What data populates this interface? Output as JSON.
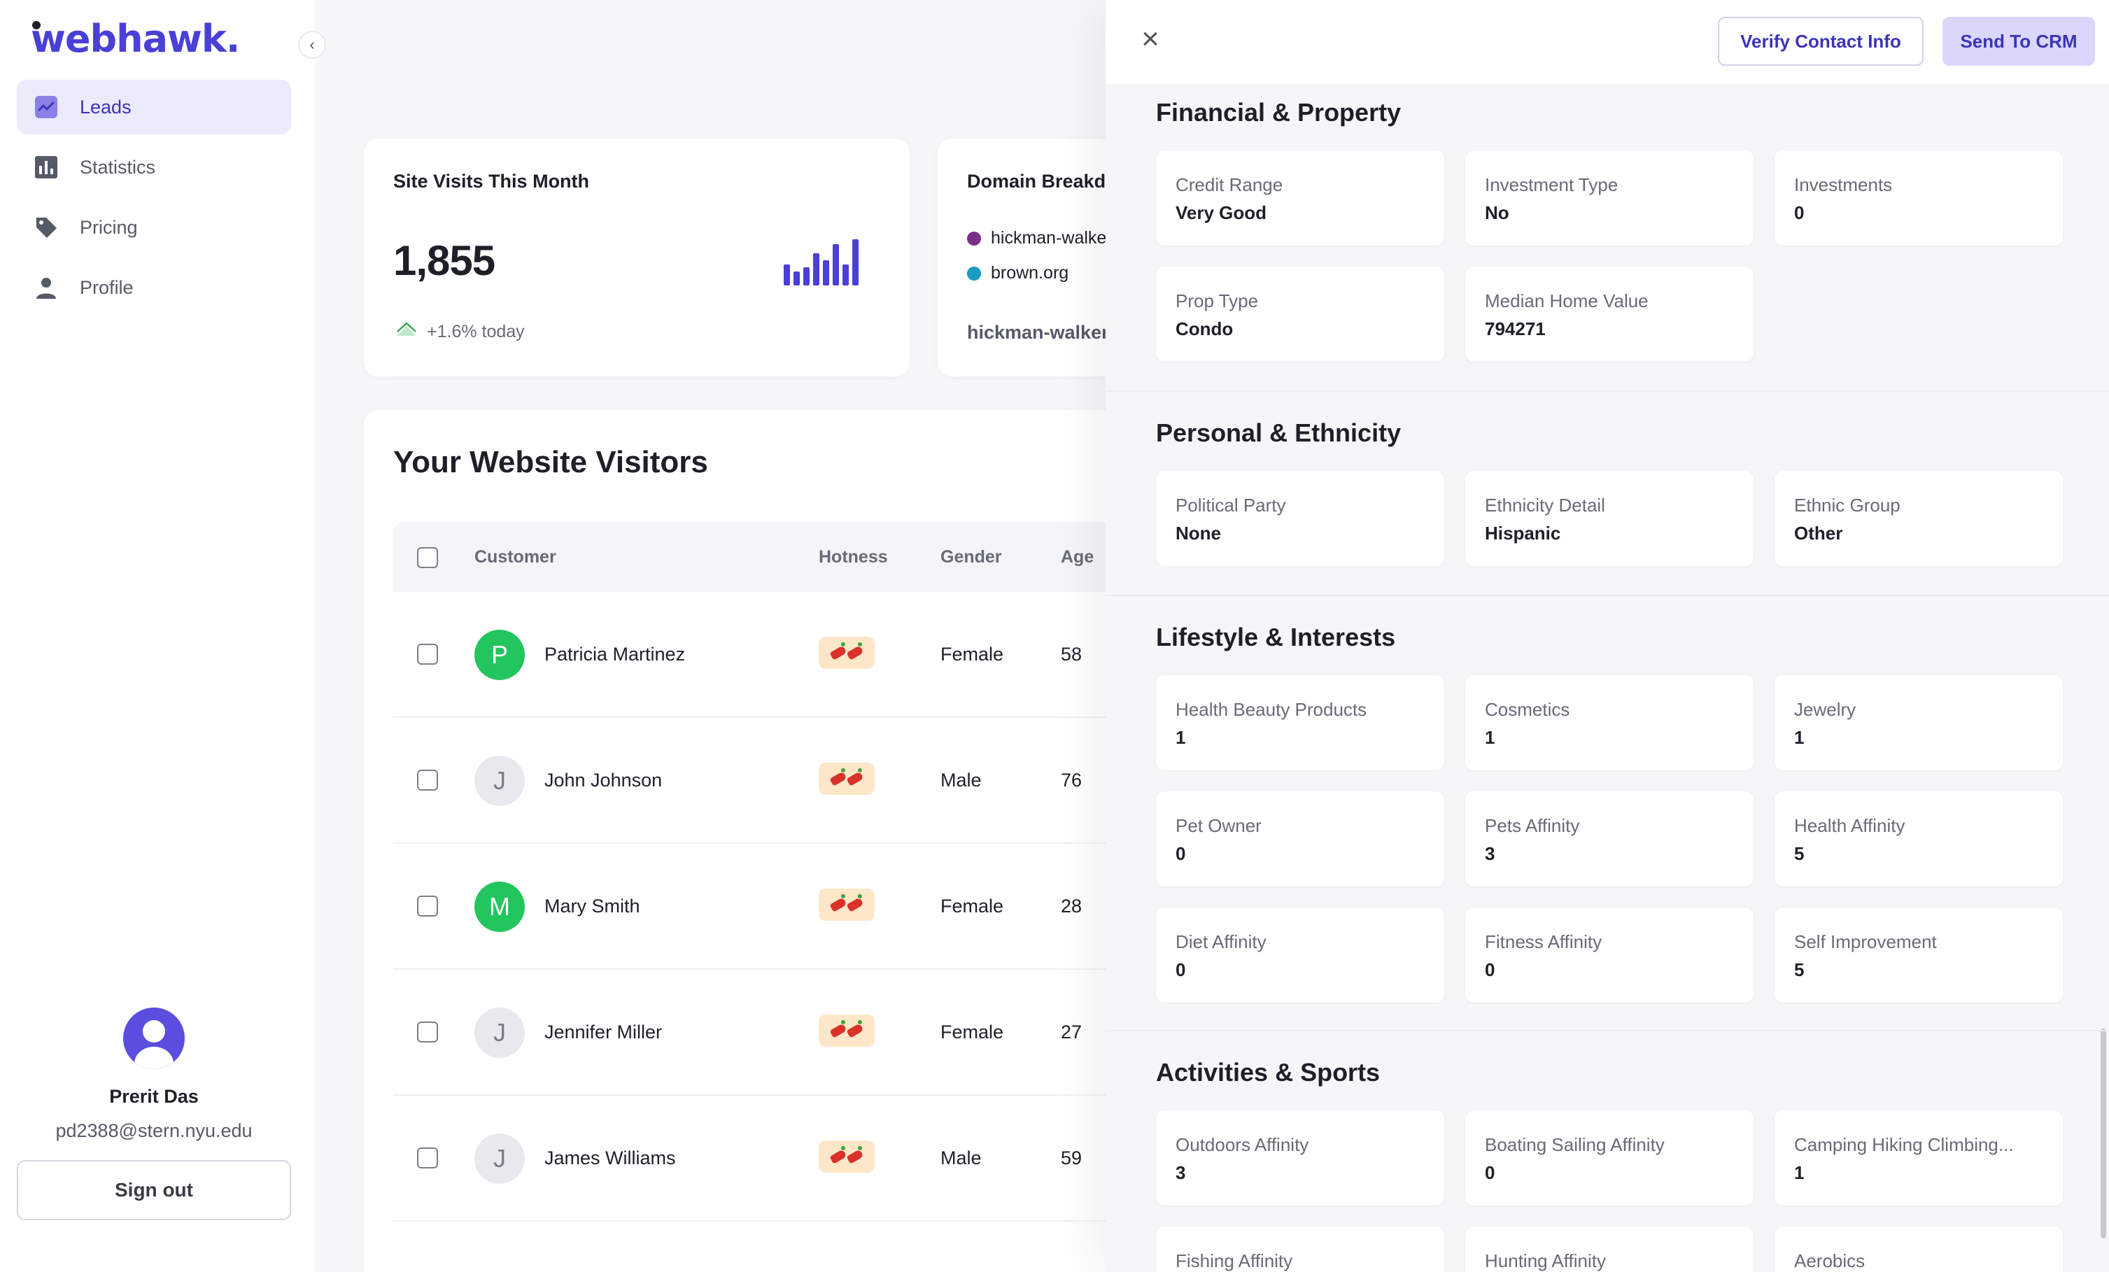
{
  "app": {
    "logo": "webhawk."
  },
  "sidebar": {
    "items": [
      {
        "label": "Leads",
        "icon": "trend-chart-icon",
        "active": true
      },
      {
        "label": "Statistics",
        "icon": "bar-chart-icon"
      },
      {
        "label": "Pricing",
        "icon": "tag-icon"
      },
      {
        "label": "Profile",
        "icon": "person-icon"
      }
    ],
    "user": {
      "name": "Prerit Das",
      "email": "pd2388@stern.nyu.edu"
    },
    "signout_label": "Sign out"
  },
  "stats": {
    "visits_title": "Site Visits This Month",
    "visits_value": "1,855",
    "visits_trend": "+1.6% today",
    "bar_levels": [
      0.45,
      0.3,
      0.4,
      0.7,
      0.55,
      0.9,
      0.45,
      1.0
    ],
    "domain_title": "Domain Breakdown",
    "domains": [
      {
        "name": "hickman-walker.com",
        "color": "#7a2f8a"
      },
      {
        "name": "brown.org",
        "color": "#1a9bc0"
      }
    ],
    "top_domain": "hickman-walker.com"
  },
  "visitors": {
    "title": "Your Website Visitors",
    "columns": {
      "customer": "Customer",
      "hotness": "Hotness",
      "gender": "Gender",
      "age": "Age"
    },
    "rows": [
      {
        "initial": "P",
        "name": "Patricia Martinez",
        "gender": "Female",
        "age": "58",
        "avatar": "green"
      },
      {
        "initial": "J",
        "name": "John Johnson",
        "gender": "Male",
        "age": "76",
        "avatar": "gray"
      },
      {
        "initial": "M",
        "name": "Mary Smith",
        "gender": "Female",
        "age": "28",
        "avatar": "green"
      },
      {
        "initial": "J",
        "name": "Jennifer Miller",
        "gender": "Female",
        "age": "27",
        "avatar": "gray"
      },
      {
        "initial": "J",
        "name": "James Williams",
        "gender": "Male",
        "age": "59",
        "avatar": "gray"
      }
    ]
  },
  "drawer": {
    "verify_label": "Verify Contact Info",
    "send_label": "Send To CRM",
    "sections": [
      {
        "title": "Financial & Property",
        "fields": [
          {
            "label": "Credit Range",
            "value": "Very Good"
          },
          {
            "label": "Investment Type",
            "value": "No"
          },
          {
            "label": "Investments",
            "value": "0"
          },
          {
            "label": "Prop Type",
            "value": "Condo"
          },
          {
            "label": "Median Home Value",
            "value": "794271"
          }
        ]
      },
      {
        "title": "Personal & Ethnicity",
        "fields": [
          {
            "label": "Political Party",
            "value": "None"
          },
          {
            "label": "Ethnicity Detail",
            "value": "Hispanic"
          },
          {
            "label": "Ethnic Group",
            "value": "Other"
          }
        ]
      },
      {
        "title": "Lifestyle & Interests",
        "fields": [
          {
            "label": "Health Beauty Products",
            "value": "1"
          },
          {
            "label": "Cosmetics",
            "value": "1"
          },
          {
            "label": "Jewelry",
            "value": "1"
          },
          {
            "label": "Pet Owner",
            "value": "0"
          },
          {
            "label": "Pets Affinity",
            "value": "3"
          },
          {
            "label": "Health Affinity",
            "value": "5"
          },
          {
            "label": "Diet Affinity",
            "value": "0"
          },
          {
            "label": "Fitness Affinity",
            "value": "0"
          },
          {
            "label": "Self Improvement",
            "value": "5"
          }
        ]
      },
      {
        "title": "Activities & Sports",
        "fields": [
          {
            "label": "Outdoors Affinity",
            "value": "3"
          },
          {
            "label": "Boating Sailing Affinity",
            "value": "0"
          },
          {
            "label": "Camping Hiking Climbing...",
            "value": "1"
          },
          {
            "label": "Fishing Affinity",
            "value": ""
          },
          {
            "label": "Hunting Affinity",
            "value": ""
          },
          {
            "label": "Aerobics",
            "value": ""
          }
        ]
      }
    ]
  },
  "colors": {
    "brand": "#4a3fd6",
    "active_bg": "#ecebfb",
    "hot_badge": "#fde7c8",
    "green_avatar": "#22c55e"
  }
}
